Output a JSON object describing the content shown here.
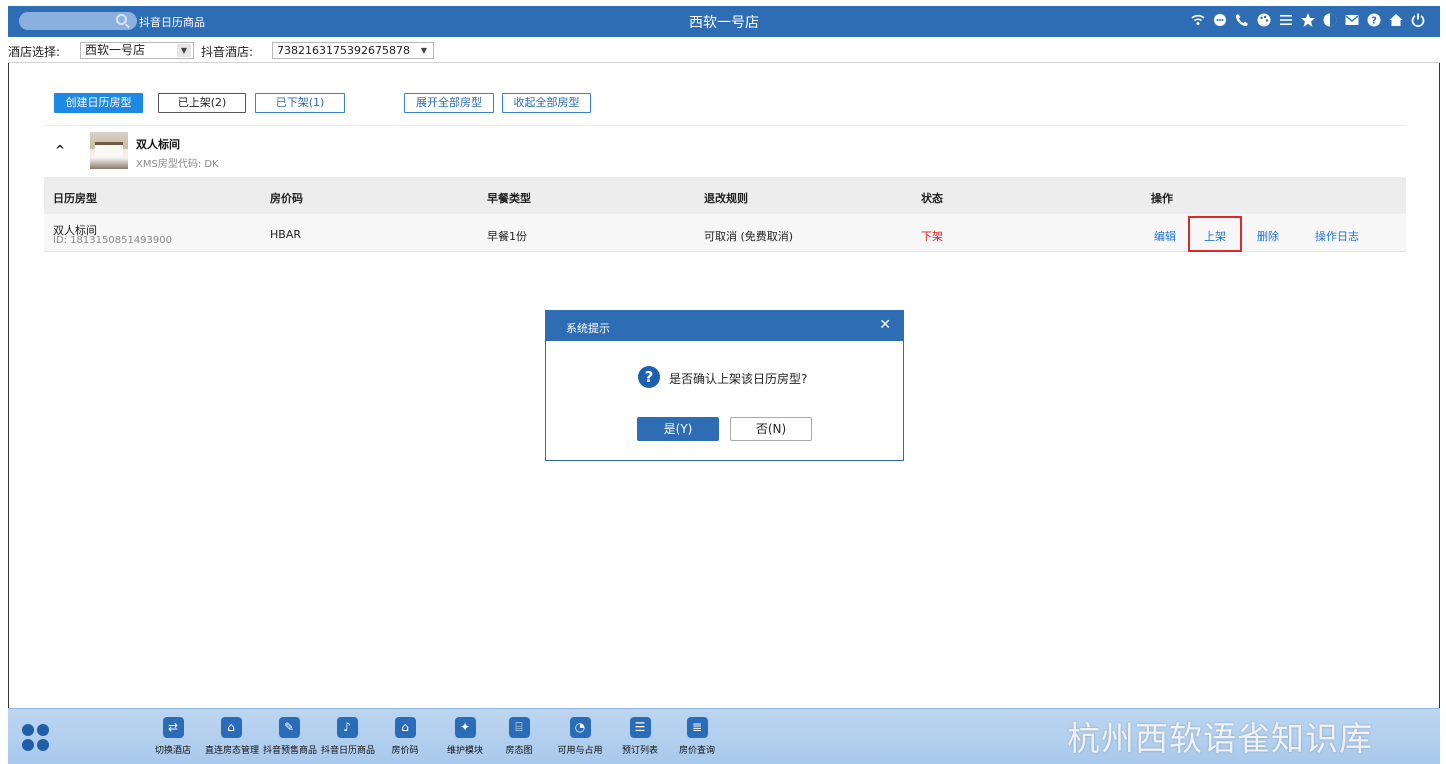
{
  "topbar": {
    "app_name": "抖音日历商品",
    "title": "西软一号店",
    "icons": [
      "wifi-icon",
      "chat-icon",
      "phone-icon",
      "palette-icon",
      "menu-icon",
      "star-icon",
      "contrast-icon",
      "mail-icon",
      "help-icon",
      "home-icon",
      "power-icon"
    ]
  },
  "selector": {
    "hotel_label": "酒店选择:",
    "hotel_value": "西软一号店",
    "douyin_label": "抖音酒店:",
    "douyin_value": "7382163175392675878"
  },
  "actions": {
    "create": "创建日历房型",
    "listed": "已上架(2)",
    "unlisted": "已下架(1)",
    "expand_all": "展开全部房型",
    "collapse_all": "收起全部房型"
  },
  "room": {
    "name": "双人标间",
    "code": "XMS房型代码: DK"
  },
  "table": {
    "headers": [
      "日历房型",
      "房价码",
      "早餐类型",
      "退改规则",
      "状态",
      "操作"
    ],
    "rows": [
      {
        "name": "双人标间",
        "id": "ID: 1813150851493900",
        "rate_code": "HBAR",
        "breakfast": "早餐1份",
        "rule": "可取消 (免费取消)",
        "status": "下架",
        "ops": [
          "编辑",
          "上架",
          "删除",
          "操作日志"
        ]
      }
    ]
  },
  "dialog": {
    "title": "系统提示",
    "message": "是否确认上架该日历房型?",
    "yes": "是(Y)",
    "no": "否(N)"
  },
  "taskbar": {
    "items": [
      {
        "label": "切换酒店",
        "icon": "switch-icon"
      },
      {
        "label": "直连房态管理",
        "icon": "room-status-icon"
      },
      {
        "label": "抖音预售商品",
        "icon": "presale-icon"
      },
      {
        "label": "抖音日历商品",
        "icon": "tiktok-icon"
      },
      {
        "label": "房价码",
        "icon": "home-icon"
      },
      {
        "label": "维护模块",
        "icon": "wrench-icon"
      },
      {
        "label": "房态图",
        "icon": "bank-icon"
      },
      {
        "label": "可用与占用",
        "icon": "pie-icon"
      },
      {
        "label": "预订列表",
        "icon": "doc-icon"
      },
      {
        "label": "房价查询",
        "icon": "query-icon"
      }
    ]
  },
  "watermark": "杭州西软语雀知识库"
}
